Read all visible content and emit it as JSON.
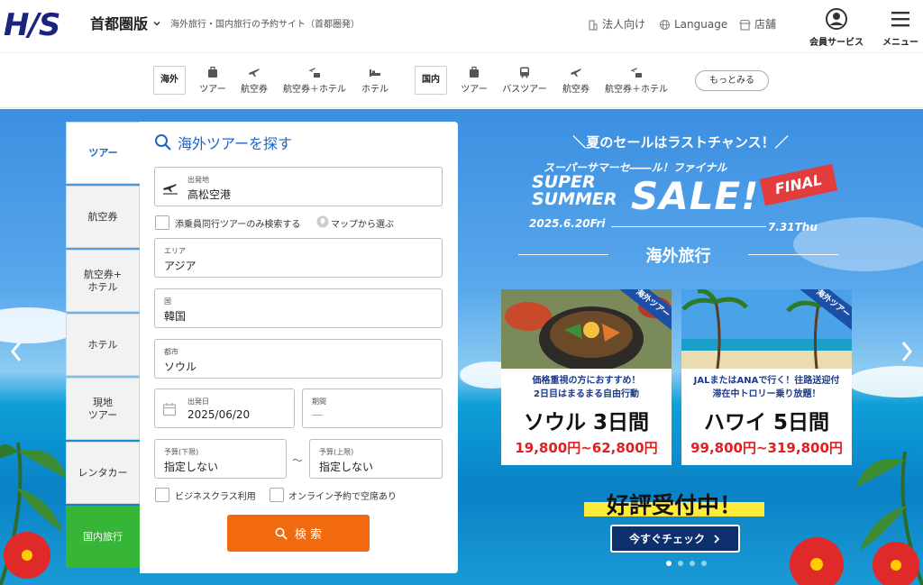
{
  "header": {
    "logo": "H/S",
    "region": "首都圏版",
    "tagline": "海外旅行・国内旅行の予約サイト（首都圏発）",
    "links": {
      "corporate": "法人向け",
      "language": "Language",
      "stores": "店舗"
    },
    "member_label": "会員サービス",
    "menu_label": "メニュー"
  },
  "nav": {
    "overseas_tag": "海外",
    "domestic_tag": "国内",
    "overseas_items": [
      "ツアー",
      "航空券",
      "航空券＋ホテル",
      "ホテル"
    ],
    "domestic_items": [
      "ツアー",
      "バスツアー",
      "航空券",
      "航空券＋ホテル"
    ],
    "more_label": "もっとみる"
  },
  "side_tabs": [
    "ツアー",
    "航空券",
    "航空券+\nホテル",
    "ホテル",
    "現地\nツアー",
    "レンタカー",
    "国内旅行"
  ],
  "search": {
    "title": "海外ツアーを探す",
    "departure": {
      "label": "出発地",
      "value": "高松空港"
    },
    "escort_only": "添乗員同行ツアーのみ検索する",
    "map_select": "マップから選ぶ",
    "area": {
      "label": "エリア",
      "value": "アジア"
    },
    "country": {
      "label": "国",
      "value": "韓国"
    },
    "city": {
      "label": "都市",
      "value": "ソウル"
    },
    "date": {
      "label": "出発日",
      "value": "2025/06/20"
    },
    "period": {
      "label": "期間",
      "value": "—"
    },
    "budget_min": {
      "label": "予算(下限)",
      "value": "指定しない"
    },
    "budget_sep": "～",
    "budget_max": {
      "label": "予算(上限)",
      "value": "指定しない"
    },
    "business_class": "ビジネスクラス利用",
    "online_available": "オンライン予約で空席あり",
    "search_button": "検 索"
  },
  "banner": {
    "hook": "＼夏のセールはラストチャンス！／",
    "subtitle": "スーパーサマーセ――ル！ファイナル",
    "super": "SUPER",
    "summer": "SUMMER",
    "sale": "SALE!",
    "final": "FINAL",
    "date_start": "2025.6.20Fri",
    "date_end": "7.31Thu",
    "category": "海外旅行",
    "cards": [
      {
        "ribbon": "海外ツアー",
        "line1": "価格重視の方におすすめ！",
        "line2": "2日目はまるまる自由行動",
        "dest": "ソウル 3日間",
        "price": "19,800円~62,800円"
      },
      {
        "ribbon": "海外ツアー",
        "line1": "JALまたはANAで行く！往路送迎付",
        "line2": "滞在中トロリー乗り放題！",
        "dest": "ハワイ 5日間",
        "price": "99,800円~319,800円"
      }
    ],
    "accepting": "好評受付中！",
    "check_button": "今すぐチェック"
  },
  "colors": {
    "brand": "#1a237e",
    "accent": "#1e64c8",
    "search_button": "#f26a10",
    "domestic": "#36b536",
    "price": "#e02020"
  }
}
